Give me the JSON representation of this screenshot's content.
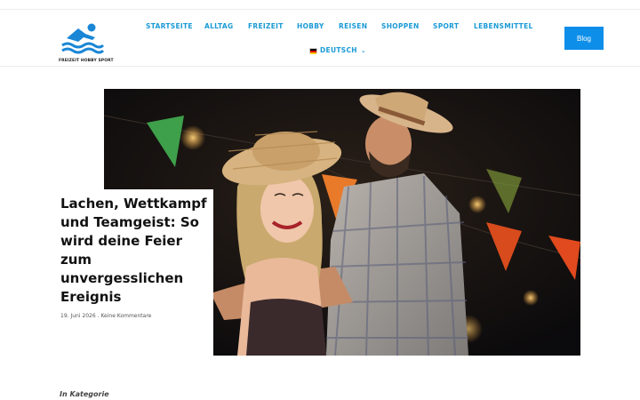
{
  "header": {
    "logo_text": "FREIZEIT HOBBY SPORT",
    "blog_button": "Blog"
  },
  "nav": {
    "items": [
      "STARTSEITE",
      "ALLTAG",
      "FREIZEIT",
      "HOBBY",
      "REISEN",
      "SHOPPEN",
      "SPORT",
      "LEBENSMITTEL"
    ],
    "language": "DEUTSCH"
  },
  "post": {
    "title": "Lachen, Wettkampf und Teamgeist: So wird deine Feier zum unvergesslichen Ereignis",
    "date": "19. Juni 2026",
    "separator": " . ",
    "comments": "Keine Kommentare"
  },
  "category": {
    "heading": "In Kategorie"
  },
  "colors": {
    "accent": "#1a9ad6",
    "button": "#0d8ee9"
  }
}
